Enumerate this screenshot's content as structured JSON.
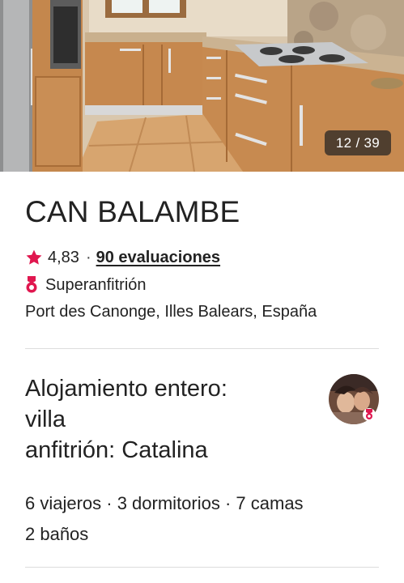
{
  "gallery": {
    "counter": "12 / 39",
    "photo_subject": "kitchen"
  },
  "listing": {
    "name": "CAN BALAMBE",
    "rating": "4,83",
    "separator": "·",
    "reviews": "90 evaluaciones",
    "host_badge": "Superanfitrión",
    "location": "Port des Canonge, Illes Balears, España",
    "title_line1": "Alojamiento entero:",
    "title_line2": "villa",
    "title_line3": "anfitrión: Catalina",
    "details_line1": "6 viajeros · 3 dormitorios · 7 camas",
    "details_line2": "2 baños"
  },
  "colors": {
    "star": "#e0174f",
    "text": "#222222",
    "divider": "#dddddd",
    "counter_bg": "#222222"
  },
  "icons": {
    "rating": "star-icon",
    "host": "superhost-medal-icon",
    "avatar": "host-avatar"
  }
}
